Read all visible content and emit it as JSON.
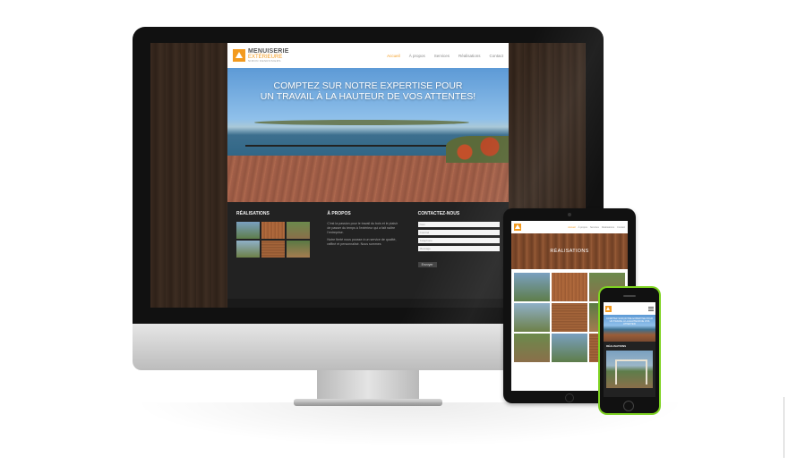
{
  "site": {
    "logo": {
      "line1": "MENUISERIE",
      "line2": "EXTÉRIEURE",
      "line3": "SIMON DESROSIERS"
    },
    "nav": [
      "Accueil",
      "À propos",
      "Services",
      "Réalisations",
      "Contact"
    ],
    "hero_headline": [
      "COMPTEZ SUR NOTRE EXPERTISE POUR",
      "UN TRAVAIL À LA HAUTEUR DE VOS ATTENTES!"
    ],
    "footer": {
      "col1_title": "RÉALISATIONS",
      "col2_title": "À PROPOS",
      "col2_text": [
        "C'est la passion pour le travail du bois et le plaisir",
        "de passer du temps à l'extérieur qui a fait naître",
        "l'entreprise.",
        "Notre fierté nous pousse à un service de qualité,",
        "raffiné et personnalisé. Nous sommes"
      ],
      "col3_title": "CONTACTEZ-NOUS",
      "form_fields": [
        "Nom",
        "Courriel",
        "Téléphone",
        "Message"
      ],
      "form_button": "Envoyer"
    }
  },
  "tablet": {
    "nav": [
      "Accueil",
      "À propos",
      "Services",
      "Réalisations",
      "Contact"
    ],
    "hero_title": "RÉALISATIONS"
  },
  "phone": {
    "hero_text": [
      "COMPTEZ SUR NOTRE EXPERTISE POUR",
      "UN TRAVAIL À LA HAUTEUR DE VOS ATTENTES!"
    ],
    "section_title": "RÉALISATIONS"
  },
  "colors": {
    "accent": "#f39a1e",
    "phone_frame": "#7ed321",
    "dark_bg": "#222222"
  }
}
